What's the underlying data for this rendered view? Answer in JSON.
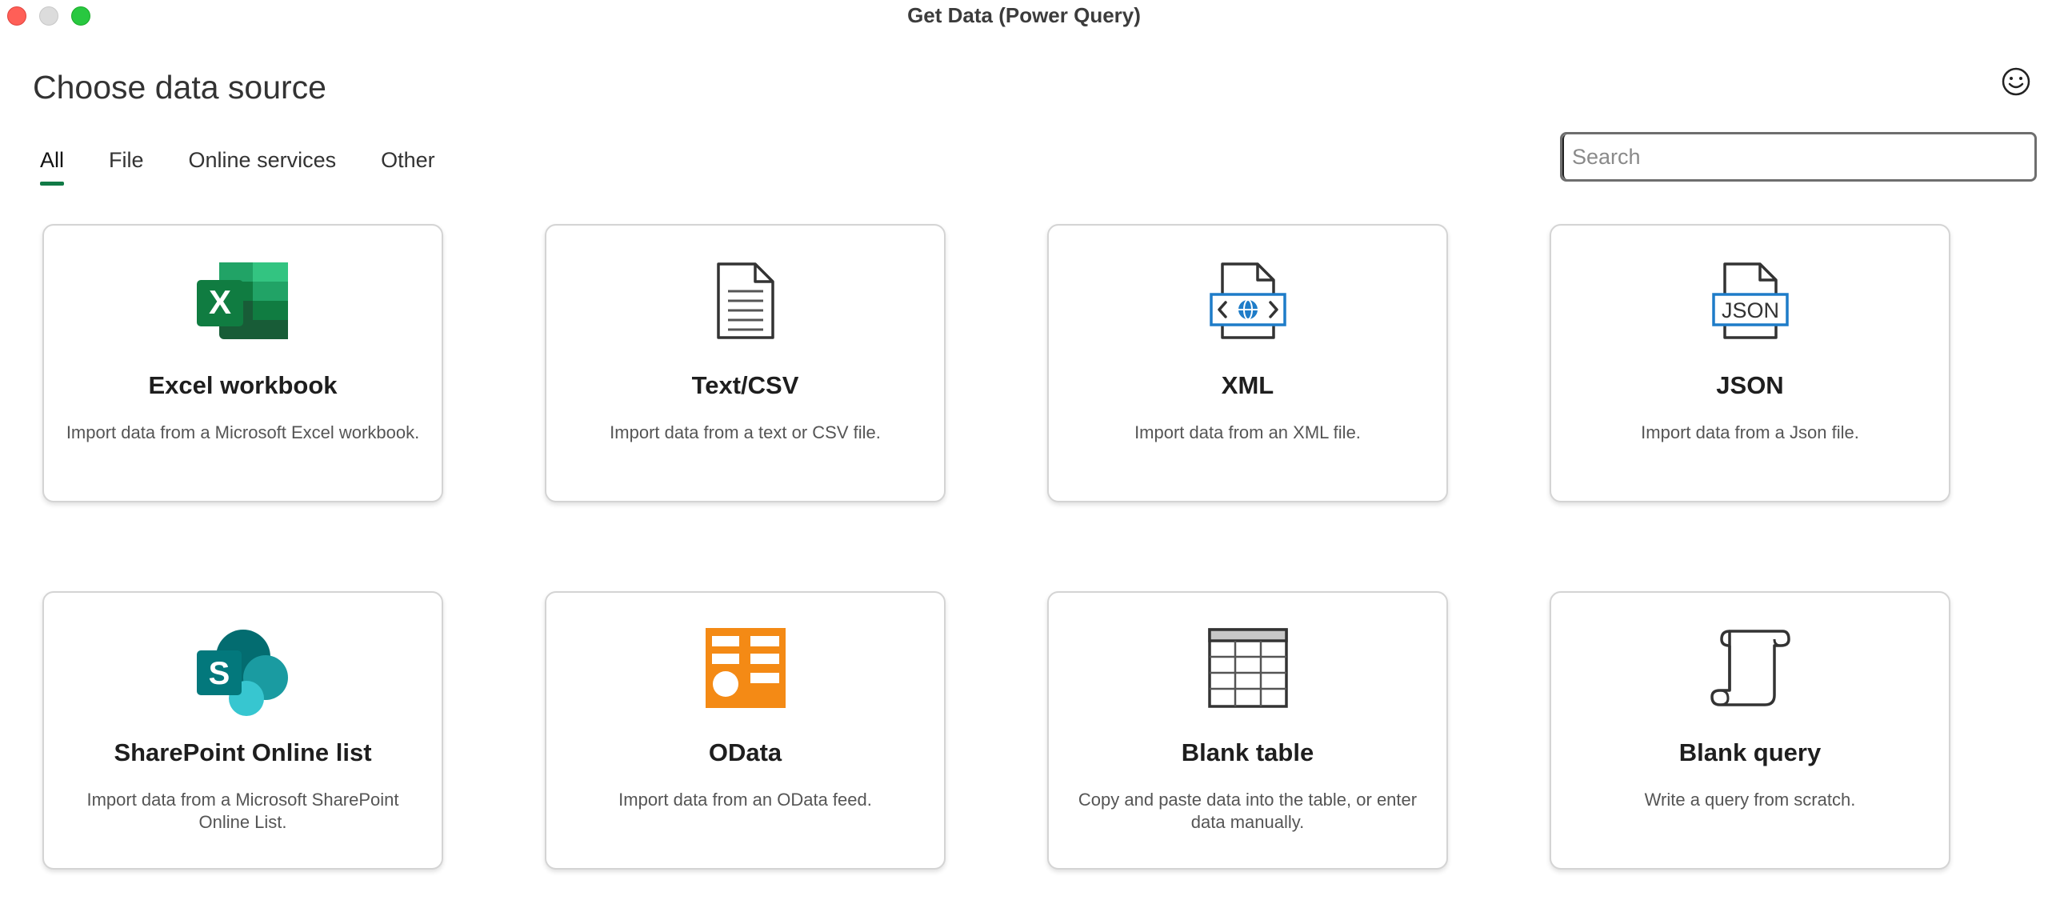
{
  "window": {
    "title": "Get Data (Power Query)"
  },
  "header": {
    "title": "Choose data source",
    "feedback_icon": "smiley-face-icon"
  },
  "tabs": [
    {
      "label": "All",
      "active": true
    },
    {
      "label": "File",
      "active": false
    },
    {
      "label": "Online services",
      "active": false
    },
    {
      "label": "Other",
      "active": false
    }
  ],
  "search": {
    "placeholder": "Search",
    "value": ""
  },
  "colors": {
    "accent": "#117a46",
    "excel": "#107c41",
    "sharepoint": "#036c70",
    "odata": "#f48a15",
    "xml_blue": "#1e7cc8"
  },
  "sources": [
    {
      "name": "Excel workbook",
      "description": "Import data from a Microsoft Excel workbook.",
      "icon": "excel-icon"
    },
    {
      "name": "Text/CSV",
      "description": "Import data from a text or CSV file.",
      "icon": "text-file-icon"
    },
    {
      "name": "XML",
      "description": "Import data from an XML file.",
      "icon": "xml-file-icon"
    },
    {
      "name": "JSON",
      "description": "Import data from a Json file.",
      "icon": "json-file-icon"
    },
    {
      "name": "SharePoint Online list",
      "description": "Import data from a Microsoft SharePoint Online List.",
      "icon": "sharepoint-icon"
    },
    {
      "name": "OData",
      "description": "Import data from an OData feed.",
      "icon": "odata-icon"
    },
    {
      "name": "Blank table",
      "description": "Copy and paste data into the table, or enter data manually.",
      "icon": "table-icon"
    },
    {
      "name": "Blank query",
      "description": "Write a query from scratch.",
      "icon": "scroll-icon"
    }
  ]
}
